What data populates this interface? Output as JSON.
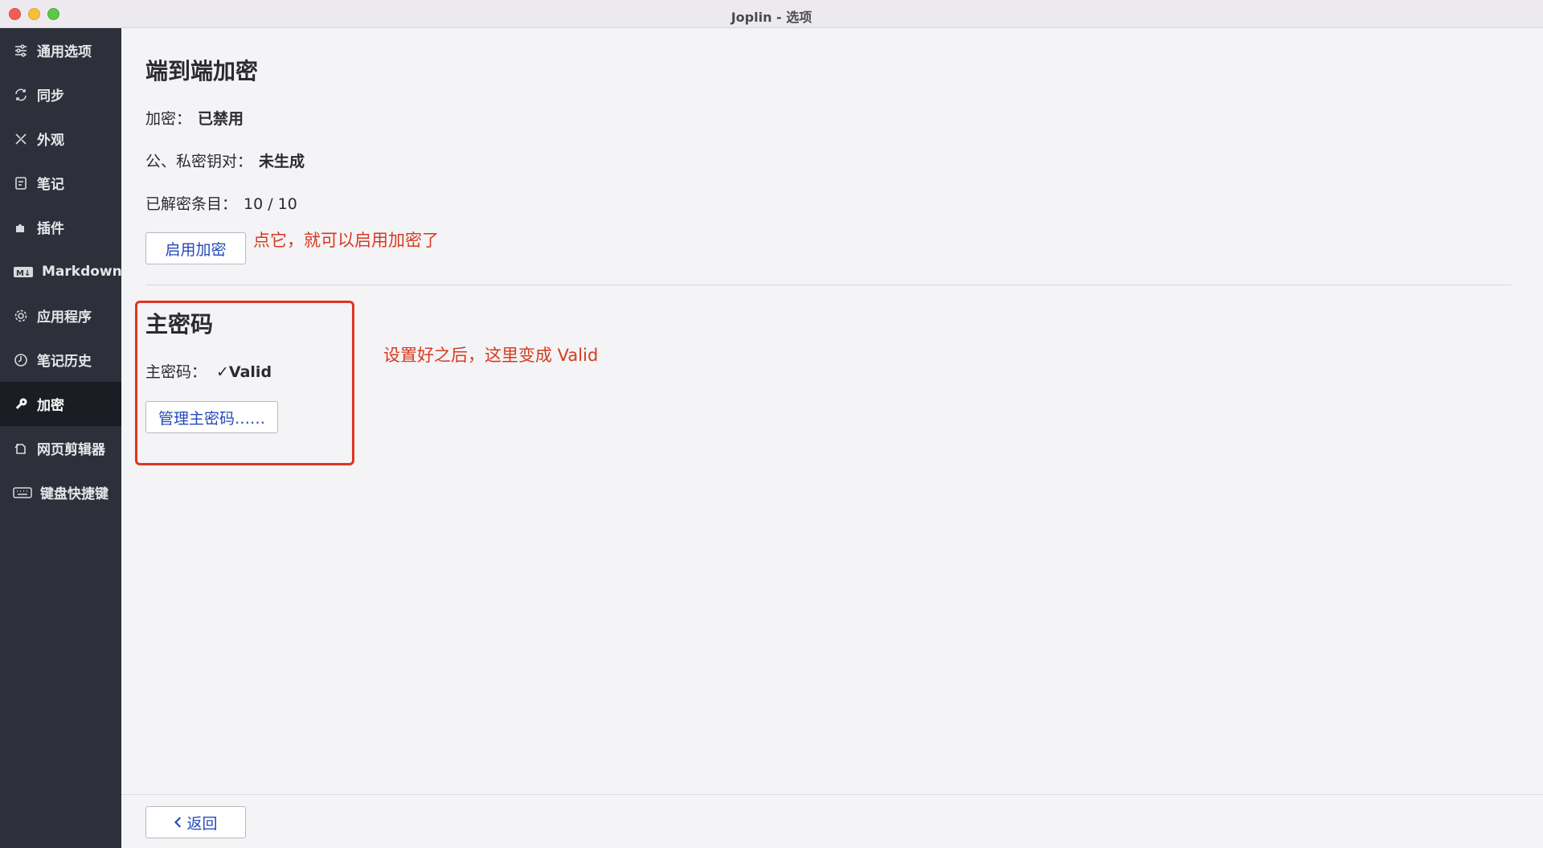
{
  "window": {
    "title": "Joplin - 选项"
  },
  "sidebar": {
    "items": [
      {
        "label": "通用选项",
        "icon": "sliders-icon"
      },
      {
        "label": "同步",
        "icon": "sync-icon"
      },
      {
        "label": "外观",
        "icon": "brush-icon"
      },
      {
        "label": "笔记",
        "icon": "note-icon"
      },
      {
        "label": "插件",
        "icon": "puzzle-icon"
      },
      {
        "label": "Markdown",
        "icon": "markdown-icon"
      },
      {
        "label": "应用程序",
        "icon": "gear-icon"
      },
      {
        "label": "笔记历史",
        "icon": "history-icon"
      },
      {
        "label": "加密",
        "icon": "key-icon",
        "active": true
      },
      {
        "label": "网页剪辑器",
        "icon": "clipper-icon"
      },
      {
        "label": "键盘快捷键",
        "icon": "keyboard-icon"
      }
    ]
  },
  "e2ee": {
    "title": "端到端加密",
    "encryption_label": "加密：",
    "encryption_value": "已禁用",
    "keypair_label": "公、私密钥对：",
    "keypair_value": "未生成",
    "decrypted_label": "已解密条目：",
    "decrypted_value": "10 / 10",
    "enable_button": "启用加密",
    "annotation": "点它，就可以启用加密了"
  },
  "master_password": {
    "title": "主密码",
    "label": "主密码：",
    "status": "✓Valid",
    "manage_button": "管理主密码……",
    "annotation": "设置好之后，这里变成 Valid"
  },
  "footer": {
    "back_button": "返回"
  },
  "colors": {
    "sidebar_bg": "#2d303a",
    "sidebar_active_bg": "#1b1d24",
    "button_text": "#2649b8",
    "annotation": "#d63a1f"
  }
}
